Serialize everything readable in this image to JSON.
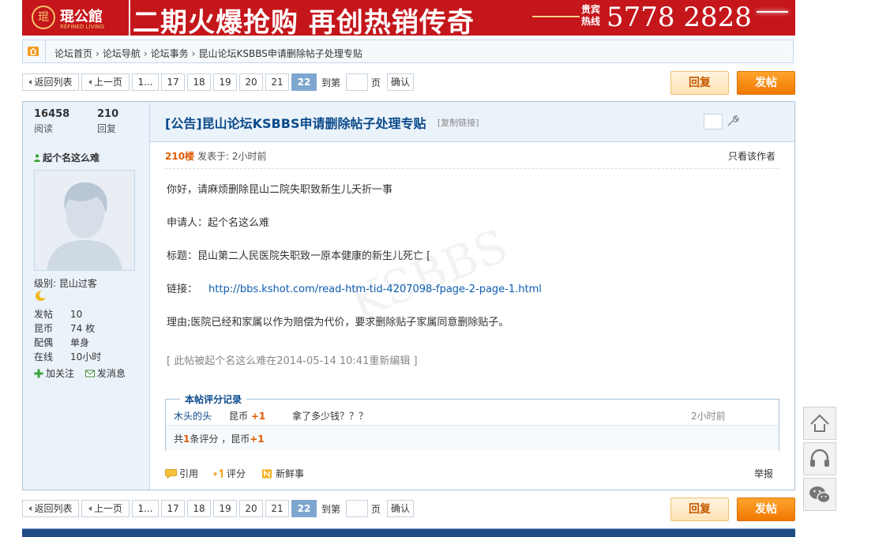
{
  "banner": {
    "logo_name": "琨公館",
    "logo_sub": "REFINED LIVING",
    "slogan": "二期火爆抢购 再创热销传奇",
    "hotline_label": "贵宾热线",
    "phone": "5778 2828"
  },
  "breadcrumb": {
    "items": [
      "论坛首页",
      "论坛导航",
      "论坛事务",
      "昆山论坛KSBBS申请删除帖子处理专贴"
    ]
  },
  "pager": {
    "back_list": "返回列表",
    "prev": "上一页",
    "first": "1...",
    "pages": [
      "17",
      "18",
      "19",
      "20",
      "21"
    ],
    "current": "22",
    "goto_label": "到第",
    "page_label": "页",
    "confirm": "确认"
  },
  "buttons": {
    "reply": "回复",
    "post": "发帖"
  },
  "thread": {
    "views": "16458",
    "views_label": "阅读",
    "replies": "210",
    "replies_label": "回复",
    "title": "[公告]昆山论坛KSBBS申请删除帖子处理专贴",
    "copy_link": "[复制链接]"
  },
  "author": {
    "name": "起个名这么难",
    "level": "级别: 昆山过客",
    "stats": [
      {
        "k": "发帖",
        "v": "10"
      },
      {
        "k": "昆币",
        "v": "74 枚"
      },
      {
        "k": "配偶",
        "v": "单身"
      },
      {
        "k": "在线",
        "v": "10小时"
      }
    ],
    "follow": "加关注",
    "message": "发消息"
  },
  "post": {
    "floor": "210楼",
    "posted": "发表于: 2小时前",
    "only_author": "只看该作者",
    "line1": "你好，请麻烦删除昆山二院失职致新生儿夭折一事",
    "line2": "申请人：起个名这么难",
    "line3": "标题：昆山第二人民医院失职致一原本健康的新生儿死亡 [",
    "link_label": "链接：",
    "link_url": "http://bbs.kshot.com/read-htm-tid-4207098-fpage-2-page-1.html",
    "line5": "理由;医院已经和家属以作为赔偿为代价，要求删除贴子家属同意删除贴子。",
    "edited": "[ 此帖被起个名这么难在2014-05-14 10:41重新编辑 ]"
  },
  "rating": {
    "legend": "本帖评分记录",
    "user": "木头的头",
    "type": "昆币",
    "delta": "+1",
    "reason": "拿了多少钱？？？",
    "time": "2小时前",
    "summary_pre": "共",
    "summary_count": "1",
    "summary_mid": "条评分 ，昆币",
    "summary_total": "+1"
  },
  "footer": {
    "quote": "引用",
    "rate": "评分",
    "fresh": "新鲜事",
    "report": "举报"
  },
  "colors": {
    "banner_red": "#c4161b",
    "title_blue": "#0a4a8a",
    "accent_orange": "#e05a00",
    "page_current": "#7ea7cf"
  }
}
